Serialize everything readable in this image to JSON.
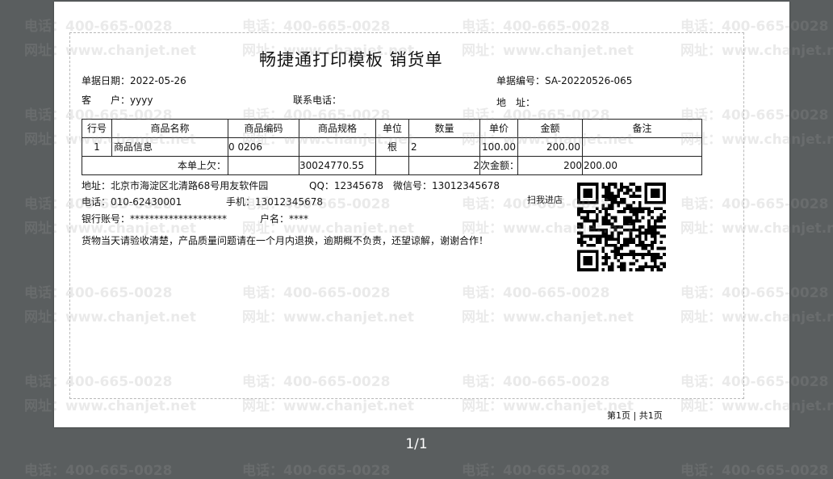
{
  "document": {
    "title": "畅捷通打印模板 销货单",
    "date_label": "单据日期：",
    "date_value": "2022-05-26",
    "number_label": "单据编号：",
    "number_value": "SA-20220526-065",
    "customer_label": "客　　户：",
    "customer_value": "yyyy",
    "contact_phone_label": "联系电话：",
    "address_label": "地　址："
  },
  "table": {
    "headers": [
      "行号",
      "商品名称",
      "商品编码",
      "商品规格",
      "单位",
      "数量",
      "单价",
      "金额",
      "备注"
    ],
    "row1": [
      "1",
      "商品信息",
      "0 0206",
      "",
      "根",
      "2",
      "100.00",
      "200.00",
      ""
    ],
    "summary": {
      "label": "本单上欠：",
      "code": "",
      "spec": "30024770.55",
      "qty_overlap": "2",
      "total_label": "次金额：",
      "total_amount": "200",
      "remark": "200.00"
    }
  },
  "footer": {
    "address": "地址：北京市海淀区北清路68号用友软件园",
    "qq": "QQ：12345678",
    "wechat": "微信号：13012345678",
    "phone": "电话：010-62430001",
    "mobile": "手机：13012345678",
    "scan_label": "扫我进店",
    "bank": "银行账号：********************",
    "account_name": "户名：****",
    "notice": "货物当天请验收清楚，产品质量问题请在一个月内退换，逾期概不负责，还望谅解，谢谢合作！",
    "page_info": "第1页 | 共1页"
  },
  "viewer": {
    "pager": "1/1"
  },
  "watermark": {
    "phone": "电话：400-665-0028",
    "site": "网址：www.chanjet.net"
  },
  "colors": {
    "background": "#5a5e5f",
    "paper": "#ffffff",
    "text": "#111111"
  }
}
